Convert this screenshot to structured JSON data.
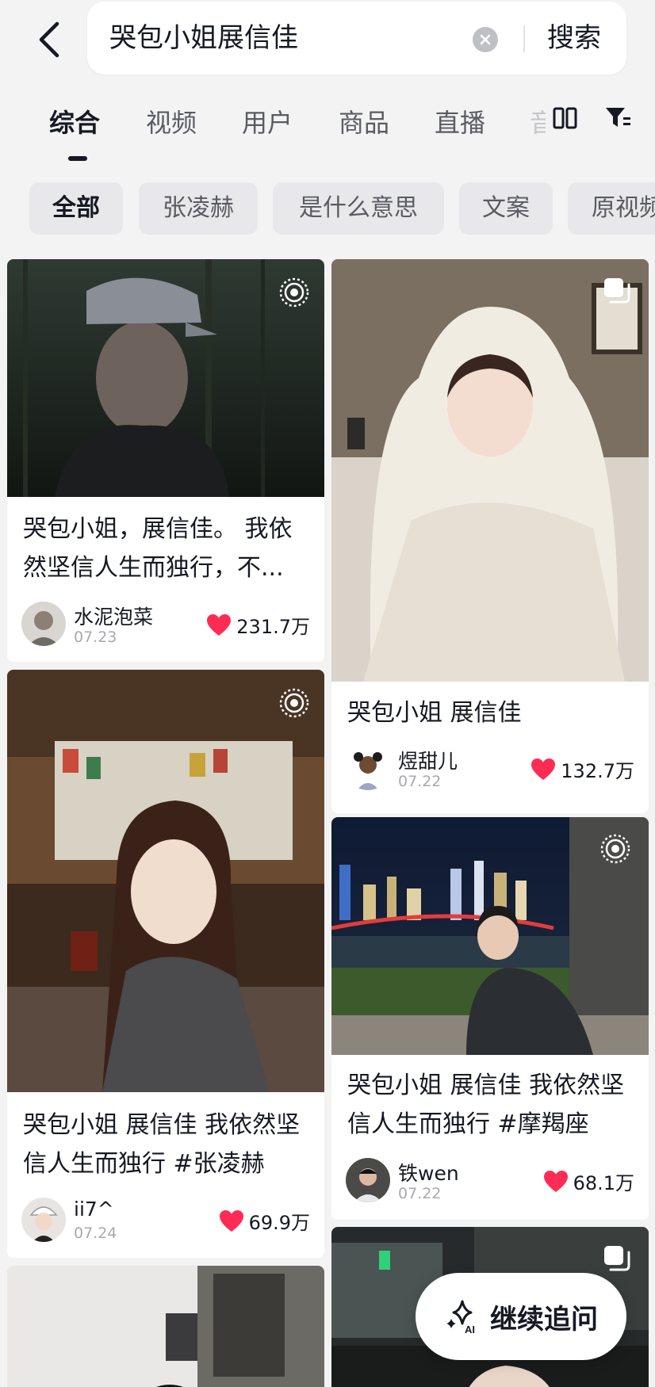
{
  "search": {
    "query": "哭包小姐展信佳",
    "button_label": "搜索"
  },
  "tabs": [
    {
      "label": "综合",
      "active": true
    },
    {
      "label": "视频"
    },
    {
      "label": "用户"
    },
    {
      "label": "商品"
    },
    {
      "label": "直播"
    },
    {
      "label": "音"
    }
  ],
  "chips": [
    {
      "label": "全部",
      "active": true
    },
    {
      "label": "张凌赫"
    },
    {
      "label": "是什么意思"
    },
    {
      "label": "文案"
    },
    {
      "label": "原视频"
    }
  ],
  "cards": [
    {
      "title": "哭包小姐，展信佳。 我依然坚信人生而独行，不...",
      "author": "水泥泡菜",
      "date": "07.23",
      "likes": "231.7万",
      "badge": "live-photo-icon"
    },
    {
      "title": "哭包小姐 展信佳",
      "author": "煜甜儿",
      "date": "07.22",
      "likes": "132.7万",
      "badge": "gallery-icon"
    },
    {
      "title": "哭包小姐 展信佳 我依然坚信人生而独行 #张凌赫",
      "author": "ii7^",
      "date": "07.24",
      "likes": "69.9万",
      "badge": "live-photo-icon"
    },
    {
      "title": "哭包小姐 展信佳 我依然坚信人生而独行 #摩羯座",
      "author": "铁wen",
      "date": "07.22",
      "likes": "68.1万",
      "badge": "live-photo-icon"
    },
    {
      "title": "",
      "author": "",
      "date": "",
      "likes": "",
      "badge": "live-photo-icon"
    },
    {
      "title": "",
      "author": "",
      "date": "",
      "likes": "",
      "badge": "gallery-icon"
    }
  ],
  "ai_button": {
    "label": "继续追问",
    "icon": "ai-sparkle-icon"
  },
  "colors": {
    "like_heart": "#fe2c55",
    "text_primary": "#161823",
    "text_secondary": "#a8a9ad",
    "background": "#f3f3f4"
  }
}
